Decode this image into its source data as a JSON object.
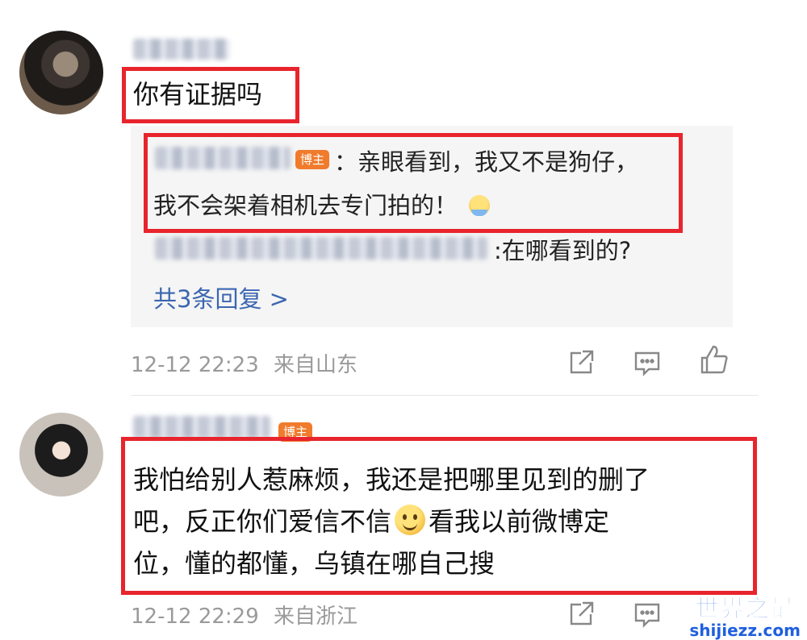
{
  "comment1": {
    "text": "你有证据吗",
    "reply_panel": {
      "reply1_text": "：亲眼看到，我又不是狗仔，",
      "reply1_text_line2": "我不会架着相机去专门拍的！",
      "reply1_badge": "博主",
      "reply2_text": ":在哪看到的?",
      "more_replies": "共3条回复 >"
    },
    "time": "12-12 22:23",
    "location": "来自山东"
  },
  "comment2": {
    "badge": "博主",
    "text_line1": "我怕给别人惹麻烦，我还是把哪里见到的删了",
    "text_line2_a": "吧，反正你们爱信不信",
    "text_line2_b": "看我以前微博定",
    "text_line3": "位，懂的都懂，乌镇在哪自己搜",
    "time": "12-12 22:29",
    "location": "来自浙江"
  },
  "icons": [
    "share-icon",
    "comment-icon",
    "like-icon"
  ],
  "watermark": {
    "title": "世界之最",
    "sub": "shijiezz.com"
  },
  "colors": {
    "highlight_border": "#e8242d",
    "badge": "#f07b2c",
    "link": "#3b66b0",
    "meta": "#9a9a9a",
    "reply_bg": "#f5f5f5"
  }
}
